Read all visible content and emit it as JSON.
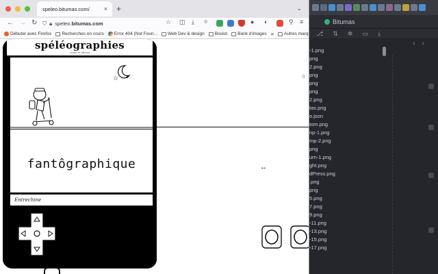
{
  "browser": {
    "tab_title": "speleo.bitumas.com/",
    "tab_close": "×",
    "new_tab": "+",
    "tab_overflow": "⌄",
    "url_domain_prefix": "speleo.",
    "url_domain": "bitumas.com",
    "nav_back": "←",
    "nav_forward": "→",
    "reload": "↻",
    "menu_glyph": "≡",
    "overflow_glyph": "»",
    "bookmarks": [
      "Débuter avec Firefox",
      "Recherches en cours",
      "Error 404 (Not Foun...",
      "Web Dev & design",
      "Boulot",
      "Bank d'images",
      "Autres marque-pages"
    ],
    "bookmarks_more": "»"
  },
  "site": {
    "title": "spéléographies",
    "subtitle": "comics de bitumas",
    "title_card_word": "fantôgraphique",
    "caption": "Entrechine"
  },
  "editor": {
    "tab_label": "Bitumas",
    "files": [
      "-1.png",
      "png",
      "2.png",
      "png",
      "png",
      "png",
      "2.png",
      "tas.png",
      "o.json",
      "tom.png",
      "np-1.png",
      "mp-2.png",
      "png",
      "urn-1.png",
      "ght.png",
      "dPress.png",
      ".png",
      "png",
      "5.png",
      "7.png",
      "9.png",
      "-11.png",
      "-13.png",
      "-15.png",
      "-17.png"
    ]
  },
  "colors": {
    "traffic_red": "#ee5b50",
    "traffic_yellow": "#f3bc3a",
    "traffic_green": "#52c13e",
    "editor_bg": "#25262b"
  }
}
